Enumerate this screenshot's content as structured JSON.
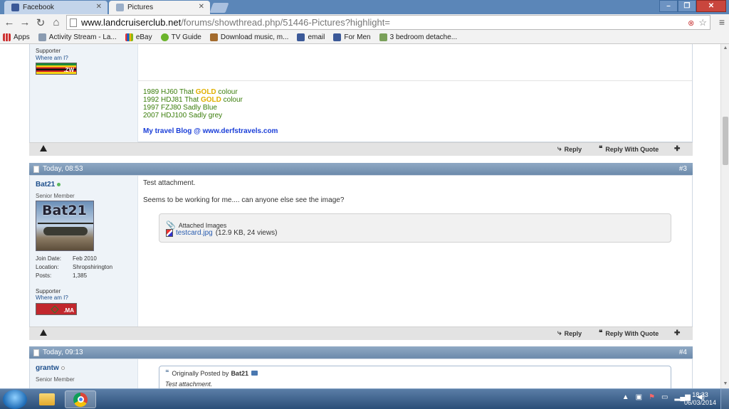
{
  "browser": {
    "tabs": [
      {
        "label": "Facebook",
        "active": false
      },
      {
        "label": "Pictures",
        "active": true
      }
    ],
    "url_host": "www.landcruiserclub.net",
    "url_path": "/forums/showthread.php/51446-Pictures?highlight=",
    "bookmarks": [
      {
        "label": "Apps",
        "icon": "apps-grid-icon"
      },
      {
        "label": "Activity Stream - La...",
        "icon": "activity-stream-icon"
      },
      {
        "label": "eBay",
        "icon": "ebay-icon"
      },
      {
        "label": "TV Guide",
        "icon": "tv-guide-icon"
      },
      {
        "label": "Download music, m...",
        "icon": "download-music-icon"
      },
      {
        "label": "email",
        "icon": "email-icon"
      },
      {
        "label": "For Men",
        "icon": "facebook-icon"
      },
      {
        "label": "3 bedroom detache...",
        "icon": "house-icon"
      }
    ]
  },
  "post_prev": {
    "supporter_label": "Supporter",
    "where_label": "Where am I?",
    "flag_code": ".ZW",
    "signature": {
      "line1_pre": "1989 HJ60 That ",
      "line1_gold": "GOLD",
      "line1_post": " colour",
      "line2_pre": "1992 HDJ81 That ",
      "line2_gold": "GOLD",
      "line2_post": " colour",
      "line3": "1997 FZJ80 Sadly Blue",
      "line4": "2007 HDJ100 Sadly grey",
      "blog": "My travel Blog @ www.derfstravels.com"
    },
    "reply_label": "Reply",
    "reply_quote_label": "Reply With Quote"
  },
  "post3": {
    "date": "Today, 08:53",
    "number": "#3",
    "username": "Bat21",
    "user_title": "Senior Member",
    "avatar_text": "Bat21",
    "join_label": "Join Date:",
    "join_value": "Feb 2010",
    "location_label": "Location:",
    "location_value": "Shropshirington",
    "posts_label": "Posts:",
    "posts_value": "1,385",
    "supporter_label": "Supporter",
    "where_label": "Where am I?",
    "flag_code": ".MA",
    "message_line1": "Test attachment.",
    "message_line2": "Seems to be working for me.... can anyone else see the image?",
    "attached_title": "Attached Images",
    "attachment_name": "testcard.jpg",
    "attachment_meta": "(12.9 KB, 24 views)",
    "reply_label": "Reply",
    "reply_quote_label": "Reply With Quote"
  },
  "post4": {
    "date": "Today, 09:13",
    "number": "#4",
    "username": "grantw",
    "user_title": "Senior Member",
    "quote_header": "Originally Posted by",
    "quote_author": "Bat21",
    "quote_text": "Test attachment."
  },
  "taskbar": {
    "time": "18:33",
    "date": "06/03/2014"
  },
  "colors": {
    "header_bar": "#6c8aab",
    "username": "#1e4f8c",
    "signature_green": "#3a7d0a",
    "gold": "#e0b000",
    "blog_link": "#1a3ed8"
  }
}
